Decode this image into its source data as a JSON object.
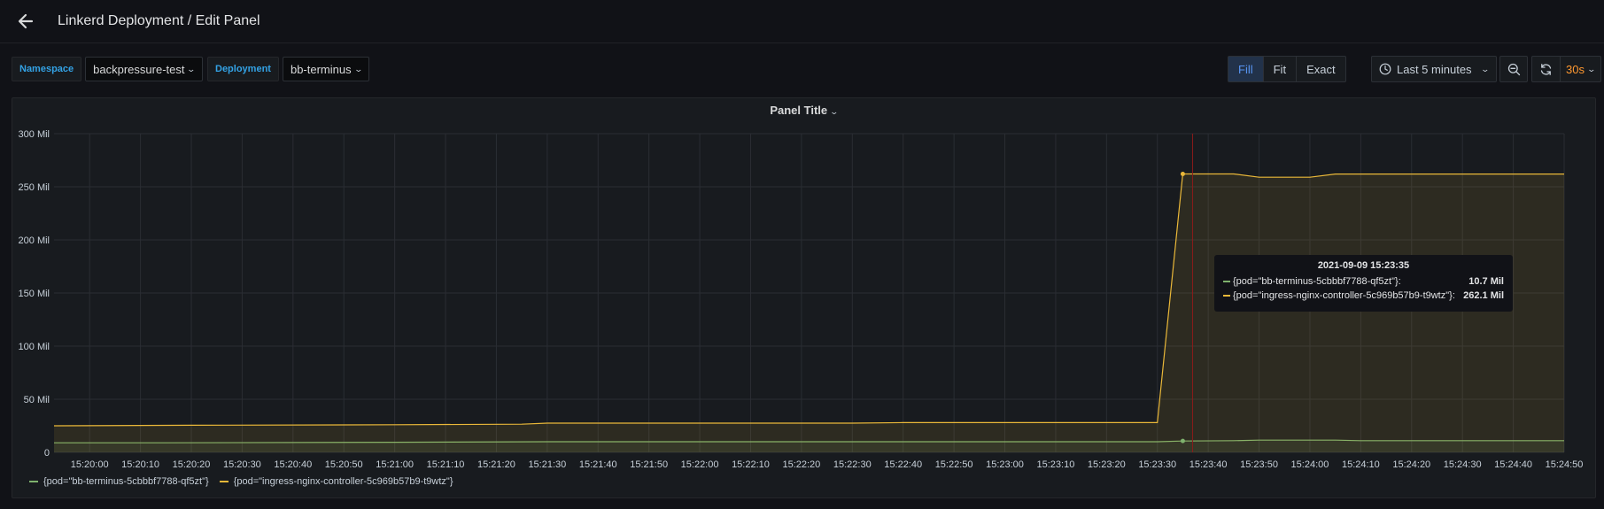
{
  "header": {
    "title": "Linkerd Deployment / Edit Panel"
  },
  "variables": [
    {
      "label": "Namespace",
      "value": "backpressure-test"
    },
    {
      "label": "Deployment",
      "value": "bb-terminus"
    }
  ],
  "display_modes": [
    "Fill",
    "Fit",
    "Exact"
  ],
  "active_mode": "Fill",
  "time_range": "Last 5 minutes",
  "refresh_interval": "30s",
  "panel": {
    "title": "Panel Title"
  },
  "colors": {
    "green": "#7eb26d",
    "yellow": "#eab839",
    "accent": "#5794f2",
    "refresh": "#ff9830",
    "crosshair": "#8b1b1b"
  },
  "tooltip": {
    "time": "2021-09-09 15:23:35",
    "rows": [
      {
        "name": "{pod=\"bb-terminus-5cbbbf7788-qf5zt\"}:",
        "value": "10.7 Mil"
      },
      {
        "name": "{pod=\"ingress-nginx-controller-5c969b57b9-t9wtz\"}:",
        "value": "262.1 Mil"
      }
    ]
  },
  "chart_data": {
    "type": "area",
    "ylim": [
      0,
      300
    ],
    "y_ticks": [
      "0",
      "50 Mil",
      "100 Mil",
      "150 Mil",
      "200 Mil",
      "250 Mil",
      "300 Mil"
    ],
    "x_ticks": [
      "15:20:00",
      "15:20:10",
      "15:20:20",
      "15:20:30",
      "15:20:40",
      "15:20:50",
      "15:21:00",
      "15:21:10",
      "15:21:20",
      "15:21:30",
      "15:21:40",
      "15:21:50",
      "15:22:00",
      "15:22:10",
      "15:22:20",
      "15:22:30",
      "15:22:40",
      "15:22:50",
      "15:23:00",
      "15:23:10",
      "15:23:20",
      "15:23:30",
      "15:23:40",
      "15:23:50",
      "15:24:00",
      "15:24:10",
      "15:24:20",
      "15:24:30",
      "15:24:40",
      "15:24:50"
    ],
    "x_start": "15:19:53",
    "x_end": "15:24:50",
    "hover_time": "15:23:35",
    "series": [
      {
        "name": "{pod=\"bb-terminus-5cbbbf7788-qf5zt\"}",
        "points": [
          [
            "15:19:53",
            9
          ],
          [
            "15:20:15",
            9
          ],
          [
            "15:21:00",
            9.5
          ],
          [
            "15:21:30",
            10
          ],
          [
            "15:22:30",
            10
          ],
          [
            "15:23:30",
            10
          ],
          [
            "15:23:35",
            10.7
          ],
          [
            "15:23:45",
            11
          ],
          [
            "15:23:50",
            11.5
          ],
          [
            "15:24:05",
            11.5
          ],
          [
            "15:24:10",
            11
          ],
          [
            "15:24:50",
            11
          ]
        ]
      },
      {
        "name": "{pod=\"ingress-nginx-controller-5c969b57b9-t9wtz\"}",
        "points": [
          [
            "15:19:53",
            25
          ],
          [
            "15:20:20",
            25.5
          ],
          [
            "15:21:00",
            26
          ],
          [
            "15:21:25",
            26.5
          ],
          [
            "15:21:30",
            27.5
          ],
          [
            "15:22:30",
            27.5
          ],
          [
            "15:22:40",
            28
          ],
          [
            "15:23:30",
            28
          ],
          [
            "15:23:35",
            262.1
          ],
          [
            "15:23:45",
            262.1
          ],
          [
            "15:23:50",
            259
          ],
          [
            "15:24:00",
            259
          ],
          [
            "15:24:05",
            262
          ],
          [
            "15:24:50",
            262
          ]
        ]
      }
    ],
    "legend": [
      "{pod=\"bb-terminus-5cbbbf7788-qf5zt\"}",
      "{pod=\"ingress-nginx-controller-5c969b57b9-t9wtz\"}"
    ]
  }
}
